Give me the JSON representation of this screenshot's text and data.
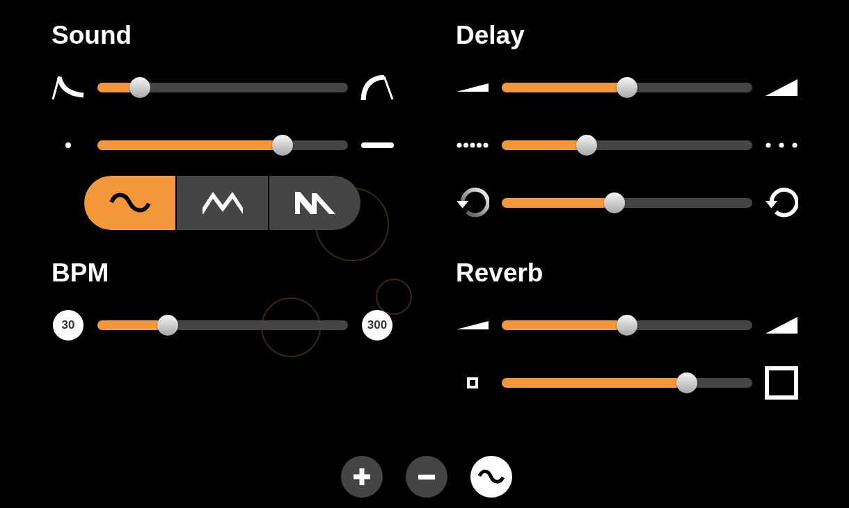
{
  "sound": {
    "title": "Sound",
    "sliders": [
      {
        "kind": "envelope",
        "level": 0.17
      },
      {
        "kind": "length",
        "level": 0.74
      }
    ],
    "waveforms": [
      {
        "kind": "sine",
        "selected": true
      },
      {
        "kind": "triangle",
        "selected": false
      },
      {
        "kind": "sawtooth",
        "selected": false
      }
    ]
  },
  "delay": {
    "title": "Delay",
    "sliders": [
      {
        "kind": "volume",
        "level": 0.5
      },
      {
        "kind": "density",
        "level": 0.34
      },
      {
        "kind": "feedback",
        "level": 0.45
      }
    ]
  },
  "bpm": {
    "title": "BPM",
    "sliders": [
      {
        "kind": "labeled",
        "min_label": "30",
        "max_label": "300",
        "level": 0.28
      }
    ]
  },
  "reverb": {
    "title": "Reverb",
    "sliders": [
      {
        "kind": "volume",
        "level": 0.5
      },
      {
        "kind": "size",
        "level": 0.74
      }
    ]
  },
  "buttons": [
    {
      "kind": "plus",
      "on": false
    },
    {
      "kind": "minus",
      "on": false
    },
    {
      "kind": "wave",
      "on": true
    }
  ]
}
